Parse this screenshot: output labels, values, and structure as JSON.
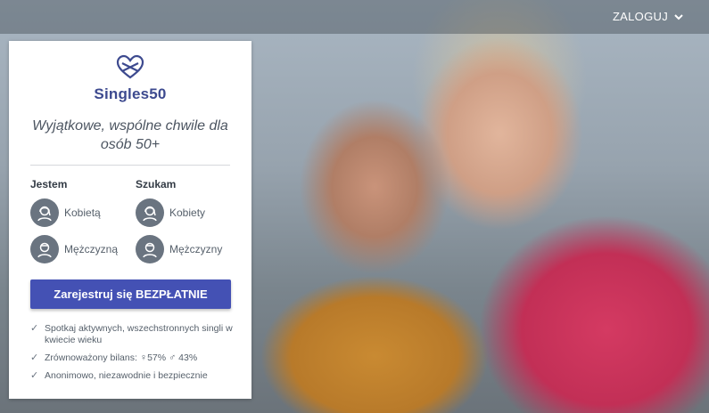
{
  "header": {
    "login_label": "ZALOGUJ",
    "login_icon": "chevron-down-icon"
  },
  "brand": {
    "name": "Singles50",
    "logo_icon": "intertwined-hearts-icon",
    "color": "#3d4a8f"
  },
  "headline": "Wyjątkowe, wspólne chwile dla osób 50+",
  "form": {
    "i_am_label": "Jestem",
    "seeking_label": "Szukam",
    "i_am_options": [
      {
        "label": "Kobietą",
        "icon": "woman-avatar-icon"
      },
      {
        "label": "Mężczyzną",
        "icon": "man-avatar-icon"
      }
    ],
    "seeking_options": [
      {
        "label": "Kobiety",
        "icon": "woman-avatar-icon"
      },
      {
        "label": "Mężczyzny",
        "icon": "man-avatar-icon"
      }
    ],
    "cta_label": "Zarejestruj się BEZPŁATNIE",
    "cta_color": "#4451b4"
  },
  "benefits": [
    {
      "text": "Spotkaj aktywnych, wszechstronnych singli w kwiecie wieku"
    },
    {
      "text_prefix": "Zrównoważony bilans:",
      "female_symbol": "♀",
      "female_pct": "57%",
      "male_symbol": "♂",
      "male_pct": "43%"
    },
    {
      "text": "Anonimowo, niezawodnie i bezpiecznie"
    }
  ]
}
